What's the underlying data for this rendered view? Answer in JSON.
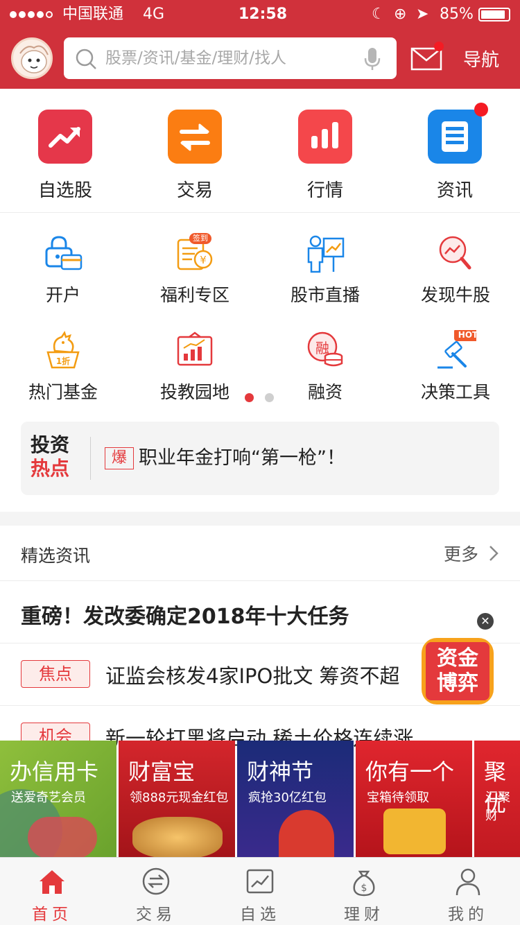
{
  "status_bar": {
    "carrier": "中国联通",
    "network": "4G",
    "time": "12:58",
    "battery": "85%"
  },
  "header": {
    "search_placeholder": "股票/资讯/基金/理财/找人",
    "nav_label": "导航"
  },
  "main_entries": [
    {
      "label": "自选股",
      "color": "#e5374a"
    },
    {
      "label": "交易",
      "color": "#fb7d12"
    },
    {
      "label": "行情",
      "color": "#f4474b"
    },
    {
      "label": "资讯",
      "color": "#1a86e8"
    }
  ],
  "grid_entries": [
    {
      "label": "开户"
    },
    {
      "label": "福利专区",
      "badge": "签到"
    },
    {
      "label": "股市直播"
    },
    {
      "label": "发现牛股"
    },
    {
      "label": "热门基金",
      "badge": "1折"
    },
    {
      "label": "投教园地"
    },
    {
      "label": "融资",
      "badge": "融"
    },
    {
      "label": "决策工具",
      "badge": "HOT"
    }
  ],
  "hot_spot": {
    "logo_line1": "投资",
    "logo_line2": "热点",
    "tag": "爆",
    "headline": "职业年金打响“第一枪”！"
  },
  "news": {
    "section_title": "精选资讯",
    "more_label": "更多",
    "headline": "重磅！发改委确定2018年十大任务",
    "items": [
      {
        "tag": "焦点",
        "title": "证监会核发4家IPO批文 筹资不超"
      },
      {
        "tag": "机会",
        "title": "新一轮打黑将启动 稀土价格连续涨"
      }
    ]
  },
  "float_badge": {
    "line1": "资金",
    "line2": "博弈"
  },
  "banners": [
    {
      "title": "办信用卡",
      "subtitle": "送爱奇艺会员"
    },
    {
      "title": "财富宝",
      "subtitle": "领888元现金红包"
    },
    {
      "title": "财神节",
      "subtitle": "疯抢30亿红包"
    },
    {
      "title": "你有一个",
      "subtitle": "宝箱待领取"
    },
    {
      "title": "聚优",
      "subtitle": "汇聚财"
    }
  ],
  "tabbar": [
    {
      "label": "首页",
      "active": true
    },
    {
      "label": "交易"
    },
    {
      "label": "自选"
    },
    {
      "label": "理财"
    },
    {
      "label": "我的"
    }
  ],
  "colors": {
    "brand_red": "#d0313b",
    "active_tab": "#e4393c"
  }
}
